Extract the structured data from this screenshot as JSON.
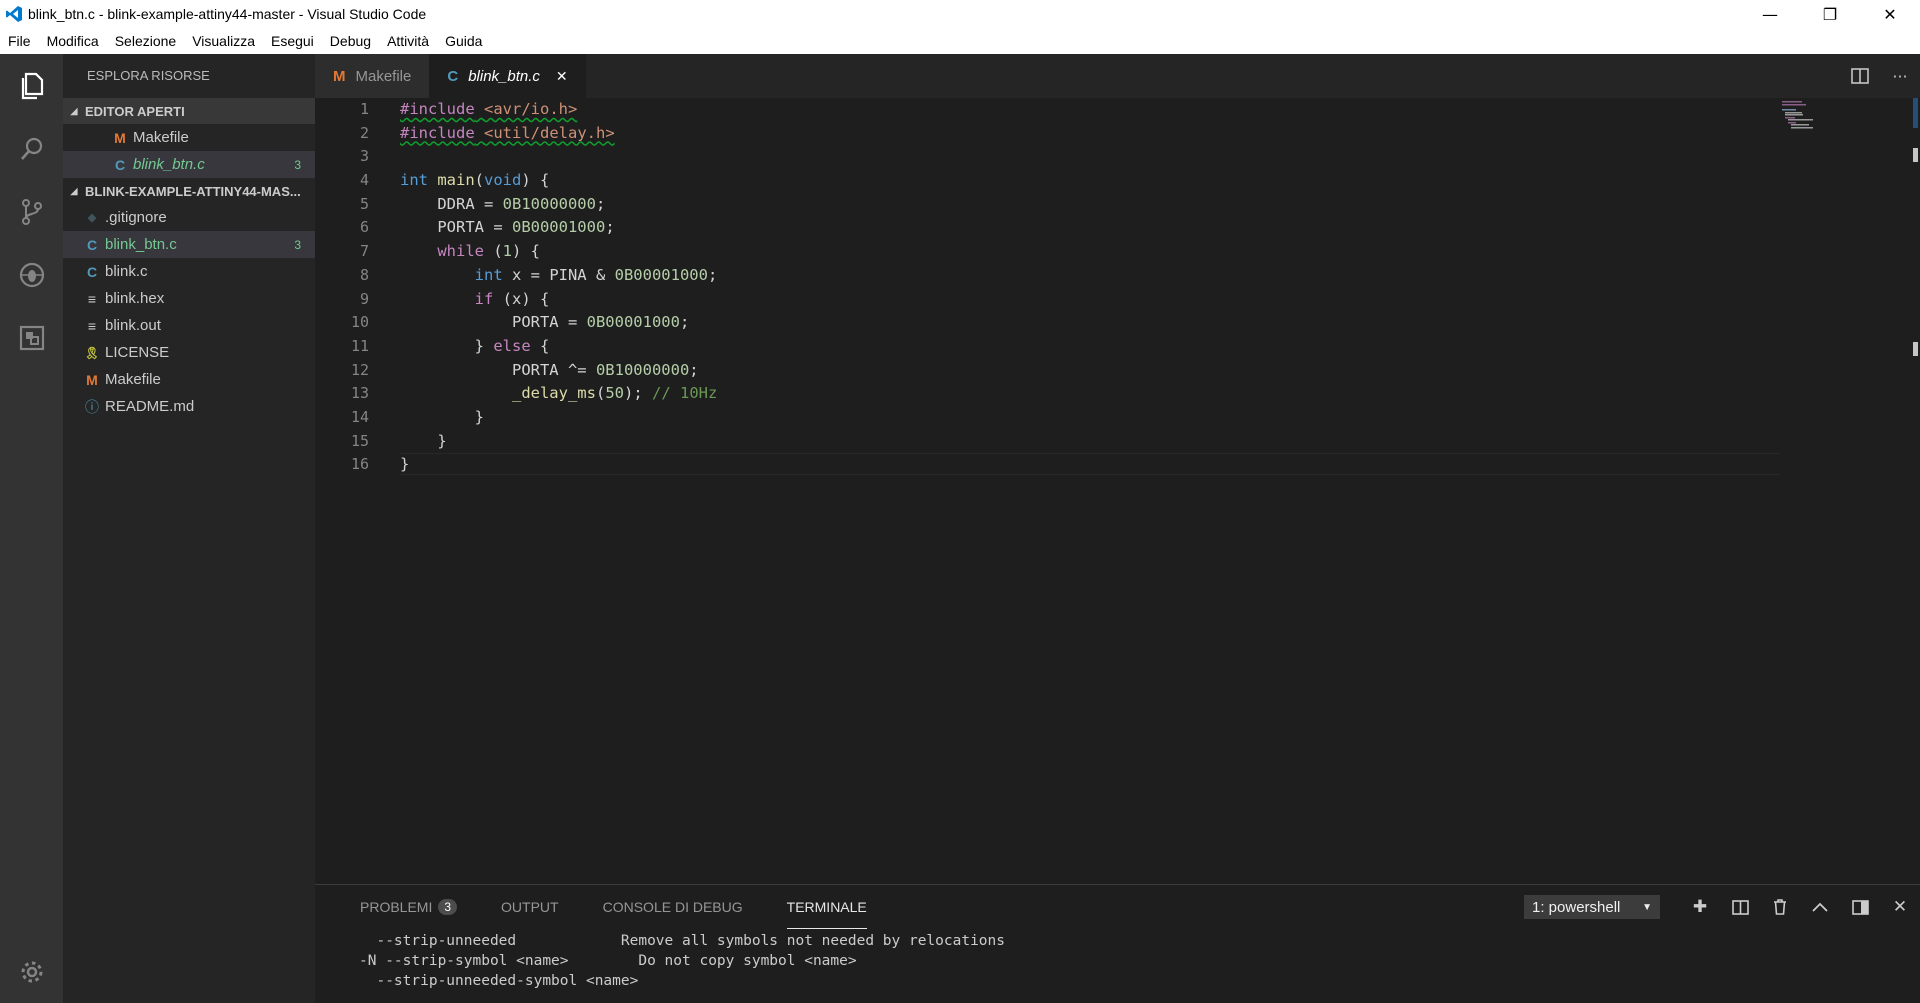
{
  "window": {
    "title": "blink_btn.c - blink-example-attiny44-master - Visual Studio Code",
    "controls": [
      "minimize",
      "restore",
      "close"
    ]
  },
  "menu": [
    "File",
    "Modifica",
    "Selezione",
    "Visualizza",
    "Esegui",
    "Debug",
    "Attività",
    "Guida"
  ],
  "sidebar": {
    "title": "ESPLORA RISORSE",
    "open_editors": {
      "header": "EDITOR APERTI",
      "items": [
        {
          "icon": "M",
          "label": "Makefile",
          "badge": ""
        },
        {
          "icon": "C",
          "label": "blink_btn.c",
          "badge": "3"
        }
      ]
    },
    "project": {
      "header": "BLINK-EXAMPLE-ATTINY44-MAS...",
      "items": [
        {
          "icon": "◆",
          "label": ".gitignore",
          "badge": ""
        },
        {
          "icon": "C",
          "label": "blink_btn.c",
          "badge": "3"
        },
        {
          "icon": "C",
          "label": "blink.c",
          "badge": ""
        },
        {
          "icon": "≡",
          "label": "blink.hex",
          "badge": ""
        },
        {
          "icon": "≡",
          "label": "blink.out",
          "badge": ""
        },
        {
          "icon": "🎗",
          "label": "LICENSE",
          "badge": ""
        },
        {
          "icon": "M",
          "label": "Makefile",
          "badge": ""
        },
        {
          "icon": "ⓘ",
          "label": "README.md",
          "badge": ""
        }
      ]
    }
  },
  "tabs": [
    {
      "icon": "M",
      "label": "Makefile"
    },
    {
      "icon": "C",
      "label": "blink_btn.c",
      "close": "✕"
    }
  ],
  "editor": {
    "line_numbers": [
      "1",
      "2",
      "3",
      "4",
      "5",
      "6",
      "7",
      "8",
      "9",
      "10",
      "11",
      "12",
      "13",
      "14",
      "15",
      "16"
    ],
    "lines": [
      "#include <avr/io.h>",
      "#include <util/delay.h>",
      "",
      "int main(void) {",
      "    DDRA = 0B10000000;",
      "    PORTA = 0B00001000;",
      "    while (1) {",
      "        int x = PINA & 0B00001000;",
      "        if (x) {",
      "            PORTA = 0B00001000;",
      "        } else {",
      "            PORTA ^= 0B10000000;",
      "            _delay_ms(50); // 10Hz",
      "        }",
      "    }",
      "}"
    ]
  },
  "panel": {
    "tabs": [
      {
        "label": "PROBLEMI",
        "badge": "3"
      },
      {
        "label": "OUTPUT"
      },
      {
        "label": "CONSOLE DI DEBUG"
      },
      {
        "label": "TERMINALE"
      }
    ],
    "terminal_select": "1: powershell",
    "terminal_lines": [
      "  --strip-unneeded            Remove all symbols not needed by relocations",
      "-N --strip-symbol <name>        Do not copy symbol <name>",
      "  --strip-unneeded-symbol <name>"
    ]
  },
  "colors": {
    "accent_makefile": "#e37933",
    "accent_c": "#519aba",
    "modified_green": "#73c991"
  }
}
